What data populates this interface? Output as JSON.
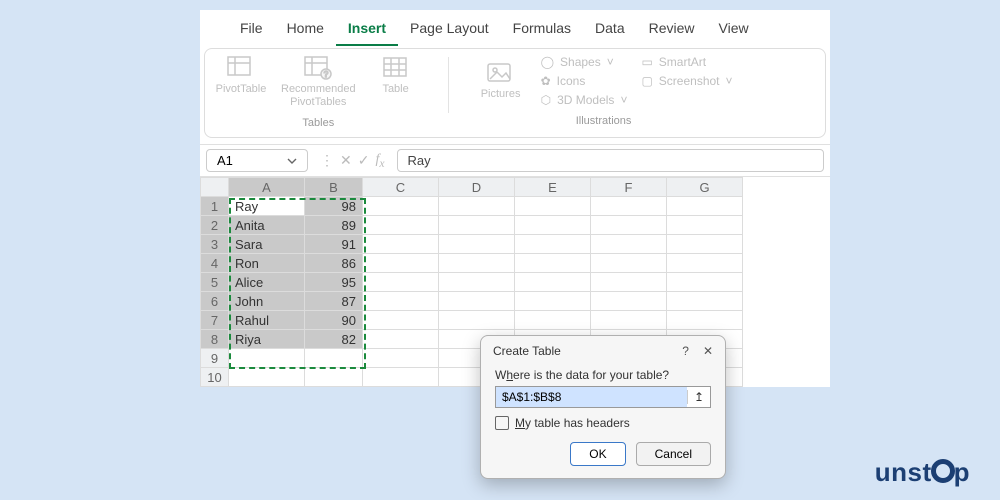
{
  "tabs": {
    "file": "File",
    "home": "Home",
    "insert": "Insert",
    "page_layout": "Page Layout",
    "formulas": "Formulas",
    "data": "Data",
    "review": "Review",
    "view": "View",
    "active": "insert"
  },
  "ribbon": {
    "tables_group_label": "Tables",
    "pivot_table": "PivotTable",
    "recommended_pivot": "Recommended\nPivotTables",
    "table": "Table",
    "illustrations_group_label": "Illustrations",
    "pictures": "Pictures",
    "shapes": "Shapes",
    "icons": "Icons",
    "models_3d": "3D Models",
    "smartart": "SmartArt",
    "screenshot": "Screenshot"
  },
  "namebox": {
    "cell": "A1",
    "formula_value": "Ray"
  },
  "columns": [
    "A",
    "B",
    "C",
    "D",
    "E",
    "F",
    "G"
  ],
  "rows": [
    {
      "n": 1,
      "a": "Ray",
      "b": "98"
    },
    {
      "n": 2,
      "a": "Anita",
      "b": "89"
    },
    {
      "n": 3,
      "a": "Sara",
      "b": "91"
    },
    {
      "n": 4,
      "a": "Ron",
      "b": "86"
    },
    {
      "n": 5,
      "a": "Alice",
      "b": "95"
    },
    {
      "n": 6,
      "a": "John",
      "b": "87"
    },
    {
      "n": 7,
      "a": "Rahul",
      "b": "90"
    },
    {
      "n": 8,
      "a": "Riya",
      "b": "82"
    },
    {
      "n": 9,
      "a": "",
      "b": ""
    },
    {
      "n": 10,
      "a": "",
      "b": ""
    }
  ],
  "dialog": {
    "title": "Create Table",
    "help": "?",
    "close": "✕",
    "prompt_pre": "W",
    "prompt_u": "h",
    "prompt_post": "ere is the data for your table?",
    "range": "$A$1:$B$8",
    "headers_pre": "M",
    "headers_u": "y",
    "headers_post": " table has headers",
    "ok": "OK",
    "cancel": "Cancel"
  },
  "brand": "unstop"
}
